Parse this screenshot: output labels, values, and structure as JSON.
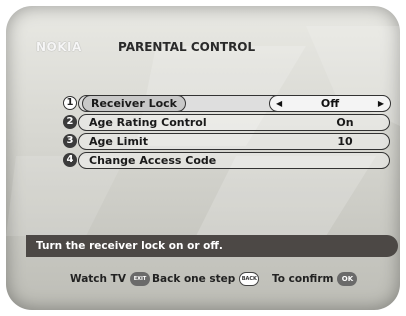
{
  "header": {
    "brand": "NOKIA",
    "title": "PARENTAL CONTROL"
  },
  "menu": {
    "items": [
      {
        "number": "1",
        "label": "Receiver Lock",
        "value": "Off",
        "selected": true
      },
      {
        "number": "2",
        "label": "Age Rating Control",
        "value": "On",
        "selected": false
      },
      {
        "number": "3",
        "label": "Age Limit",
        "value": "10",
        "selected": false
      },
      {
        "number": "4",
        "label": "Change Access Code",
        "value": "",
        "selected": false
      }
    ],
    "left_arrow_icon": "left-triangle-icon",
    "right_arrow_icon": "right-triangle-icon"
  },
  "help_text": "Turn the receiver lock on or off.",
  "footer": {
    "watch_tv_label": "Watch TV",
    "watch_tv_key": "EXIT",
    "back_label": "Back one step",
    "back_key": "BACK",
    "confirm_label": "To confirm",
    "confirm_key": "OK"
  },
  "colors": {
    "help_bar": "#4c4845",
    "screen_bg": "#d6d6d0"
  }
}
